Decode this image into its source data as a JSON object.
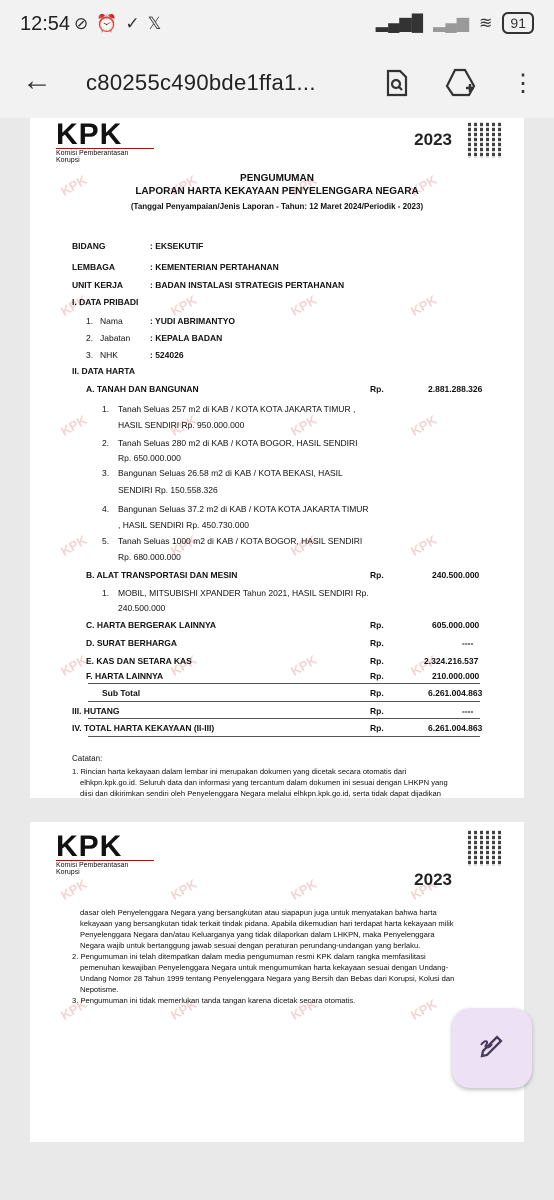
{
  "status": {
    "time": "12:54",
    "battery": "91"
  },
  "toolbar": {
    "back_icon": "arrow-back-icon",
    "file_name": "c80255c490bde1ffa1...",
    "icons": [
      "search-doc-icon",
      "drive-add-icon",
      "more-vert-icon"
    ]
  },
  "doc_header": {
    "logo_text": "KPK",
    "logo_sub": "Komisi Pemberantasan Korupsi",
    "year": "2023",
    "watermark": "KPK"
  },
  "heading": {
    "line1": "PENGUMUMAN",
    "line2": "LAPORAN HARTA KEKAYAAN PENYELENGGARA NEGARA",
    "line3": "(Tanggal Penyampaian/Jenis Laporan - Tahun: 12 Maret 2024/Periodik - 2023)"
  },
  "info": [
    {
      "label": "BIDANG",
      "value": "EKSEKUTIF"
    },
    {
      "label": "LEMBAGA",
      "value": "KEMENTERIAN PERTAHANAN"
    },
    {
      "label": "UNIT KERJA",
      "value": "BADAN INSTALASI STRATEGIS PERTAHANAN"
    }
  ],
  "data_pribadi": {
    "title": "I.   DATA PRIBADI",
    "rows": [
      {
        "no": "1.",
        "label": "Nama",
        "value": "YUDI ABRIMANTYO"
      },
      {
        "no": "2.",
        "label": "Jabatan",
        "value": "KEPALA BADAN"
      },
      {
        "no": "3.",
        "label": "NHK",
        "value": "524026"
      }
    ]
  },
  "data_harta": {
    "title": "II.  DATA HARTA",
    "a_label": "A.   TANAH DAN BANGUNAN",
    "a_rp": "Rp.",
    "a_value": "2.881.288.326",
    "a_items": [
      {
        "no": "1.",
        "l1": "Tanah Seluas 257 m2 di KAB / KOTA KOTA JAKARTA TIMUR ,",
        "l2": "HASIL SENDIRI Rp. 950.000.000"
      },
      {
        "no": "2.",
        "l1": "Tanah Seluas 280 m2 di KAB / KOTA BOGOR, HASIL SENDIRI",
        "l2": "Rp. 650.000.000"
      },
      {
        "no": "3.",
        "l1": "Bangunan Seluas 26.58 m2 di KAB / KOTA BEKASI, HASIL",
        "l2": "SENDIRI Rp. 150.558.326"
      },
      {
        "no": "4.",
        "l1": "Bangunan Seluas 37.2 m2 di KAB / KOTA KOTA JAKARTA TIMUR",
        "l2": ", HASIL SENDIRI Rp. 450.730.000"
      },
      {
        "no": "5.",
        "l1": "Tanah Seluas 1000 m2 di KAB / KOTA BOGOR, HASIL SENDIRI",
        "l2": "Rp. 680.000.000"
      }
    ],
    "b_label": "B.   ALAT TRANSPORTASI DAN MESIN",
    "b_rp": "Rp.",
    "b_value": "240.500.000",
    "b_item": {
      "no": "1.",
      "l1": "MOBIL, MITSUBISHI XPANDER Tahun 2021, HASIL SENDIRI Rp.",
      "l2": "240.500.000"
    },
    "others": [
      {
        "label": "C.   HARTA BERGERAK LAINNYA",
        "rp": "Rp.",
        "value": "605.000.000"
      },
      {
        "label": "D.   SURAT BERHARGA",
        "rp": "Rp.",
        "value": "----"
      },
      {
        "label": "E.   KAS DAN SETARA KAS",
        "rp": "Rp.",
        "value": "2.324.216.537"
      },
      {
        "label": "F.   HARTA LAINNYA",
        "rp": "Rp.",
        "value": "210.000.000"
      },
      {
        "label": "Sub Total",
        "rp": "Rp.",
        "value": "6.261.004.863"
      }
    ]
  },
  "hutang": {
    "label": "III. HUTANG",
    "rp": "Rp.",
    "value": "----"
  },
  "total": {
    "label": "IV. TOTAL HARTA KEKAYAAN (II-III)",
    "rp": "Rp.",
    "value": "6.261.004.863"
  },
  "catatan": {
    "title": "Catatan:",
    "p1_l1": "1. Rincian harta kekayaan dalam lembar ini merupakan dokumen yang dicetak secara otomatis dari",
    "p1_l2": "elhkpn.kpk.go.id. Seluruh data dan informasi yang tercantum dalam dokumen ini sesuai dengan LHKPN yang",
    "p1_l3": "diisi dan dikirimkan sendiri oleh Penyelenggara Negara melalui elhkpn.kpk.go.id, serta tidak dapat dijadikan"
  },
  "page2_text": [
    "dasar oleh Penyelenggara Negara yang bersangkutan atau siapapun juga untuk menyatakan bahwa harta",
    "kekayaan yang bersangkutan tidak terkait tindak pidana. Apabila dikemudian hari terdapat harta kekayaan milik",
    "Penyelenggara Negara dan/atau Keluarganya yang tidak dilaporkan dalam LHKPN, maka Penyelenggara",
    "Negara wajib untuk bertanggung jawab sesuai dengan peraturan perundang-undangan yang berlaku.",
    "2. Pengumuman ini telah ditempatkan dalam media pengumuman resmi KPK dalam rangka memfasilitasi",
    "pemenuhan kewajiban Penyelenggara Negara untuk mengumumkan harta kekayaan sesuai dengan Undang-",
    "Undang Nomor 28 Tahun 1999 tentang Penyelenggara Negara yang Bersih dan Bebas dari Korupsi, Kolusi dan",
    "Nepotisme.",
    "3. Pengumuman ini tidak memerlukan tanda tangan karena dicetak secara otomatis."
  ],
  "fab": {
    "icon": "edit-sign-icon"
  }
}
